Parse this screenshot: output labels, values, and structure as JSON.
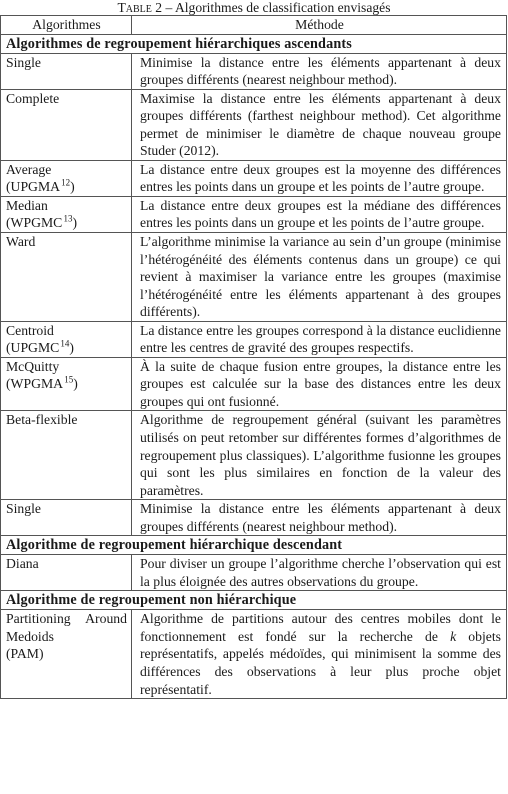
{
  "caption": {
    "label": "Table 2",
    "separator": " – ",
    "text": "Algorithmes de classification envisagés"
  },
  "headers": {
    "col1": "Algorithmes",
    "col2": "Méthode"
  },
  "sections": [
    {
      "title": "Algorithmes de regroupement hiérarchiques ascendants",
      "rows": [
        {
          "name": "Single",
          "name_note": "",
          "name_sup": "",
          "name_close": "",
          "description": "Minimise la distance entre les éléments appartenant à deux groupes différents (nearest neighbour method)."
        },
        {
          "name": "Complete",
          "name_note": "",
          "name_sup": "",
          "name_close": "",
          "description": "Maximise la distance entre les éléments appartenant à deux groupes différents (farthest neighbour method). Cet algorithme permet de minimiser le diamètre de chaque nouveau groupe Studer (2012)."
        },
        {
          "name": "Average",
          "name_note": "(UPGMA",
          "name_sup": "12",
          "name_close": ")",
          "description": "La distance entre deux groupes est la moyenne des différences entres les points dans un groupe et les points de l’autre groupe."
        },
        {
          "name": "Median",
          "name_note": "(WPGMC",
          "name_sup": "13",
          "name_close": ")",
          "description": "La distance entre deux groupes est la médiane des différences entres les points dans un groupe et les points de l’autre groupe."
        },
        {
          "name": "Ward",
          "name_note": "",
          "name_sup": "",
          "name_close": "",
          "description": "L’algorithme minimise la variance au sein d’un groupe (minimise l’hétérogénéité des éléments contenus dans un groupe) ce qui revient à maximiser la variance entre les groupes (maximise l’hétérogénéité entre les éléments appartenant à des groupes différents)."
        },
        {
          "name": "Centroid",
          "name_note": "(UPGMC",
          "name_sup": "14",
          "name_close": ")",
          "description": "La distance entre les groupes correspond à la distance euclidienne entre les centres de gravité des groupes respectifs."
        },
        {
          "name": "McQuitty",
          "name_note": "(WPGMA",
          "name_sup": "15",
          "name_close": ")",
          "description": "À la suite de chaque fusion entre groupes, la distance entre les groupes est calculée sur la base des distances entre les deux groupes qui ont fusionné."
        },
        {
          "name": "Beta-flexible",
          "name_note": "",
          "name_sup": "",
          "name_close": "",
          "description": "Algorithme de regroupement général (suivant les paramètres utilisés on peut retomber sur différentes formes d’algorithmes de regroupement plus classiques). L’algorithme fusionne les groupes qui sont les plus similaires en fonction de la valeur des paramètres."
        },
        {
          "name": "Single",
          "name_note": "",
          "name_sup": "",
          "name_close": "",
          "description": "Minimise la distance entre les éléments appartenant à deux groupes différents (nearest neighbour method)."
        }
      ]
    },
    {
      "title": "Algorithme de regroupement hiérarchique descendant",
      "rows": [
        {
          "name": "Diana",
          "name_note": "",
          "name_sup": "",
          "name_close": "",
          "description": "Pour diviser un groupe l’algorithme cherche l’observation qui est la plus éloignée des autres observations du groupe."
        }
      ]
    },
    {
      "title": "Algorithme de regroupement non hiérarchique",
      "rows": [
        {
          "name": "Partitioning Around Medoids",
          "name_note": "(PAM)",
          "name_sup": "",
          "name_close": "",
          "description_before_k": "Algorithme de partitions autour des centres mobiles dont le fonctionnement est fondé sur la recherche de ",
          "description_k": "k",
          "description_after_k": " objets représentatifs, appelés médoïdes, qui minimisent la somme des différences des observations à leur plus proche objet représentatif."
        }
      ]
    }
  ]
}
